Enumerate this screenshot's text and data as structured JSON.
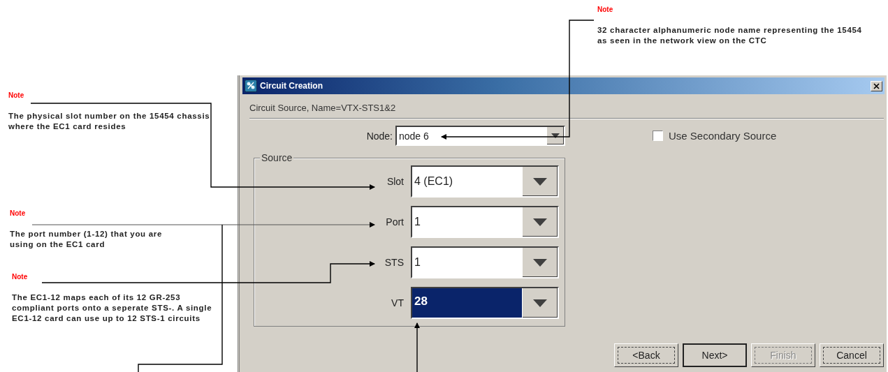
{
  "annotations": [
    {
      "label": "Note",
      "text": "32 character alphanumeric node name representing the 15454 as seen in the network view on the CTC"
    },
    {
      "label": "Note",
      "text": "The physical slot number on the 15454 chassis where the EC1 card resides"
    },
    {
      "label": "Note",
      "text": "The port number (1-12) that you are using on the EC1 card"
    },
    {
      "label": "Note",
      "text": "The EC1-12 maps each of its 12 GR-253 compliant ports onto a seperate STS-. A single EC1-12 card can use up to 12 STS-1 circuits"
    }
  ],
  "dialog": {
    "title": "Circuit Creation",
    "subtitle": "Circuit Source, Name=VTX-STS1&2",
    "node": {
      "label": "Node:",
      "value": "node 6"
    },
    "secondary_source": {
      "label": "Use Secondary Source",
      "checked": false
    },
    "source_group": {
      "title": "Source",
      "fields": [
        {
          "label": "Slot",
          "value": "4 (EC1)",
          "selected": false
        },
        {
          "label": "Port",
          "value": "1",
          "selected": false
        },
        {
          "label": "STS",
          "value": "1",
          "selected": false
        },
        {
          "label": "VT",
          "value": "28",
          "selected": true
        }
      ]
    },
    "buttons": [
      {
        "label": "<Back",
        "default": false,
        "disabled": false
      },
      {
        "label": "Next>",
        "default": true,
        "disabled": false
      },
      {
        "label": "Finish",
        "default": false,
        "disabled": true
      },
      {
        "label": "Cancel",
        "default": false,
        "disabled": false
      }
    ]
  }
}
